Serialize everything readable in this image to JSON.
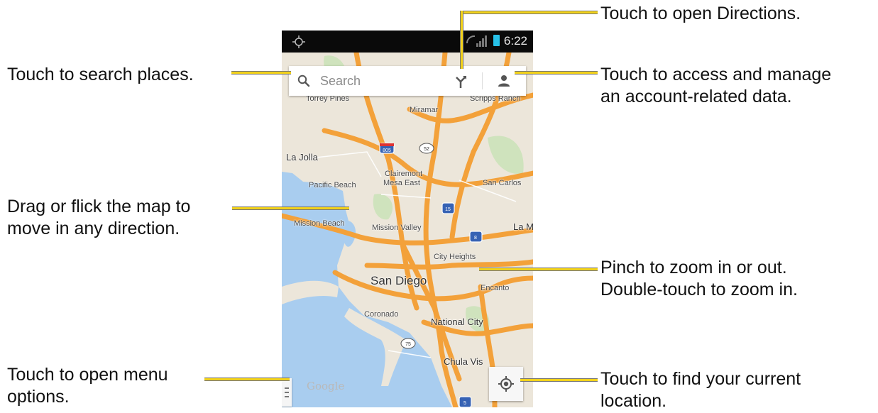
{
  "annotations": {
    "search": "Touch to search places.",
    "drag_1": "Drag or flick the map to",
    "drag_2": "move in any direction.",
    "menu_1": "Touch to open menu",
    "menu_2": "options.",
    "directions": "Touch to open Directions.",
    "account_1": "Touch to access and manage",
    "account_2": "an account-related data.",
    "zoom_1": "Pinch to zoom in or out.",
    "zoom_2": "Double-touch to zoom in.",
    "location_1": "Touch to find your current",
    "location_2": "location."
  },
  "phone": {
    "status_time": "6:22",
    "search_placeholder": "Search",
    "map_logo": "Google",
    "map_labels": {
      "torrey_pines": "Torrey Pines",
      "scripps_ranch": "Scripps Ranch",
      "miramar": "Miramar",
      "la_jolla": "La Jolla",
      "clairemont": "Clairemont",
      "mesa_east": "Mesa East",
      "pacific_beach": "Pacific Beach",
      "san_carlos": "San Carlos",
      "mission_beach": "Mission Beach",
      "mission_valley": "Mission Valley",
      "la_mesa": "La M",
      "city_heights": "City Heights",
      "san_diego": "San Diego",
      "encanto": "Encanto",
      "coronado": "Coronado",
      "national_city": "National City",
      "chula_vista": "Chula Vis",
      "shield_805": "805",
      "shield_52": "52",
      "shield_15": "15",
      "shield_8": "8",
      "shield_75": "75",
      "shield_5": "5"
    }
  },
  "colors": {
    "leader": "#f2d21b",
    "water": "#a9cdef",
    "land": "#ece6da",
    "highway": "#f3a13a"
  }
}
